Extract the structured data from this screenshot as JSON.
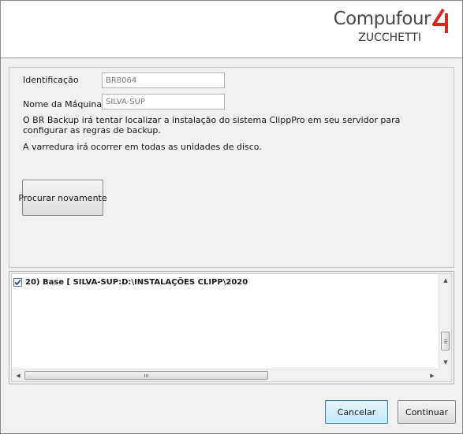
{
  "brand": {
    "name": "Compufour",
    "subtitle": "ZUCCHETTI",
    "primary_color": "#4a4a4a",
    "accent_color": "#d62a20",
    "icon": "compufour-4-logo-icon"
  },
  "form": {
    "identificacao": {
      "label": "Identificação",
      "value": "BR8064"
    },
    "nome_maquina": {
      "label": "Nome da Máquina",
      "value": "SILVA-SUP"
    },
    "description_1": "O BR Backup irá tentar localizar a instalação do sistema ClippPro em seu servidor para configurar as regras de backup.",
    "description_2": "A varredura irá ocorrer em todas as unidades de disco.",
    "search_again_label": "Procurar novamente"
  },
  "results": {
    "items": [
      {
        "checked": true,
        "text": "20) Base [ SILVA-SUP:D:\\INSTALAÇÕES CLIPP\\2020"
      }
    ]
  },
  "footer": {
    "cancel_label": "Cancelar",
    "continue_label": "Continuar"
  }
}
